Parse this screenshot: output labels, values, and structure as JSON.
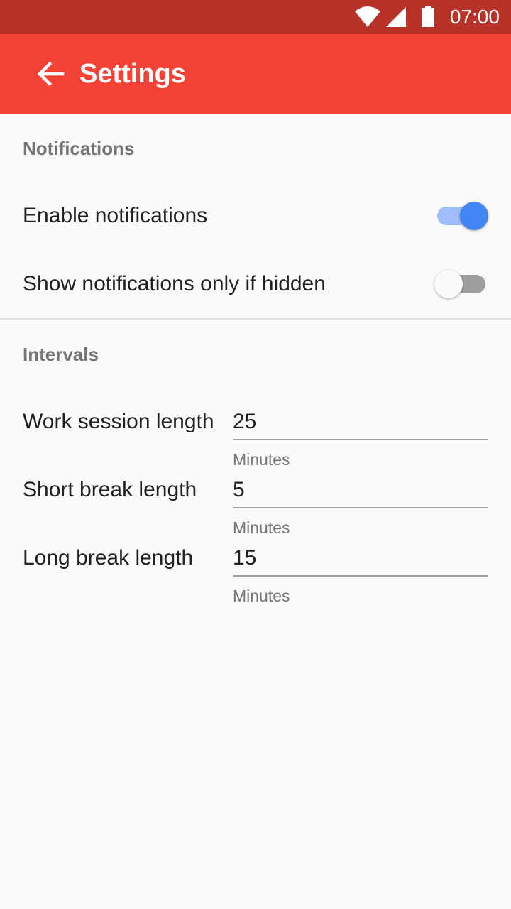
{
  "status_bar": {
    "time": "07:00",
    "icons": [
      "wifi-icon",
      "cell-signal-icon",
      "battery-icon"
    ]
  },
  "app_bar": {
    "title": "Settings",
    "back_icon": "arrow-left-icon"
  },
  "notifications": {
    "section_title": "Notifications",
    "enable": {
      "label": "Enable notifications",
      "checked": true
    },
    "only_if_hidden": {
      "label": "Show notifications only if hidden",
      "checked": false
    }
  },
  "intervals": {
    "section_title": "Intervals",
    "work": {
      "label": "Work session length",
      "value": "25",
      "helper": "Minutes"
    },
    "short_break": {
      "label": "Short break length",
      "value": "5",
      "helper": "Minutes"
    },
    "long_break": {
      "label": "Long break length",
      "value": "15",
      "helper": "Minutes"
    }
  },
  "colors": {
    "status_bar": "#b8322a",
    "app_bar": "#f44336",
    "switch_accent": "#4285f4",
    "background": "#fafafa"
  }
}
